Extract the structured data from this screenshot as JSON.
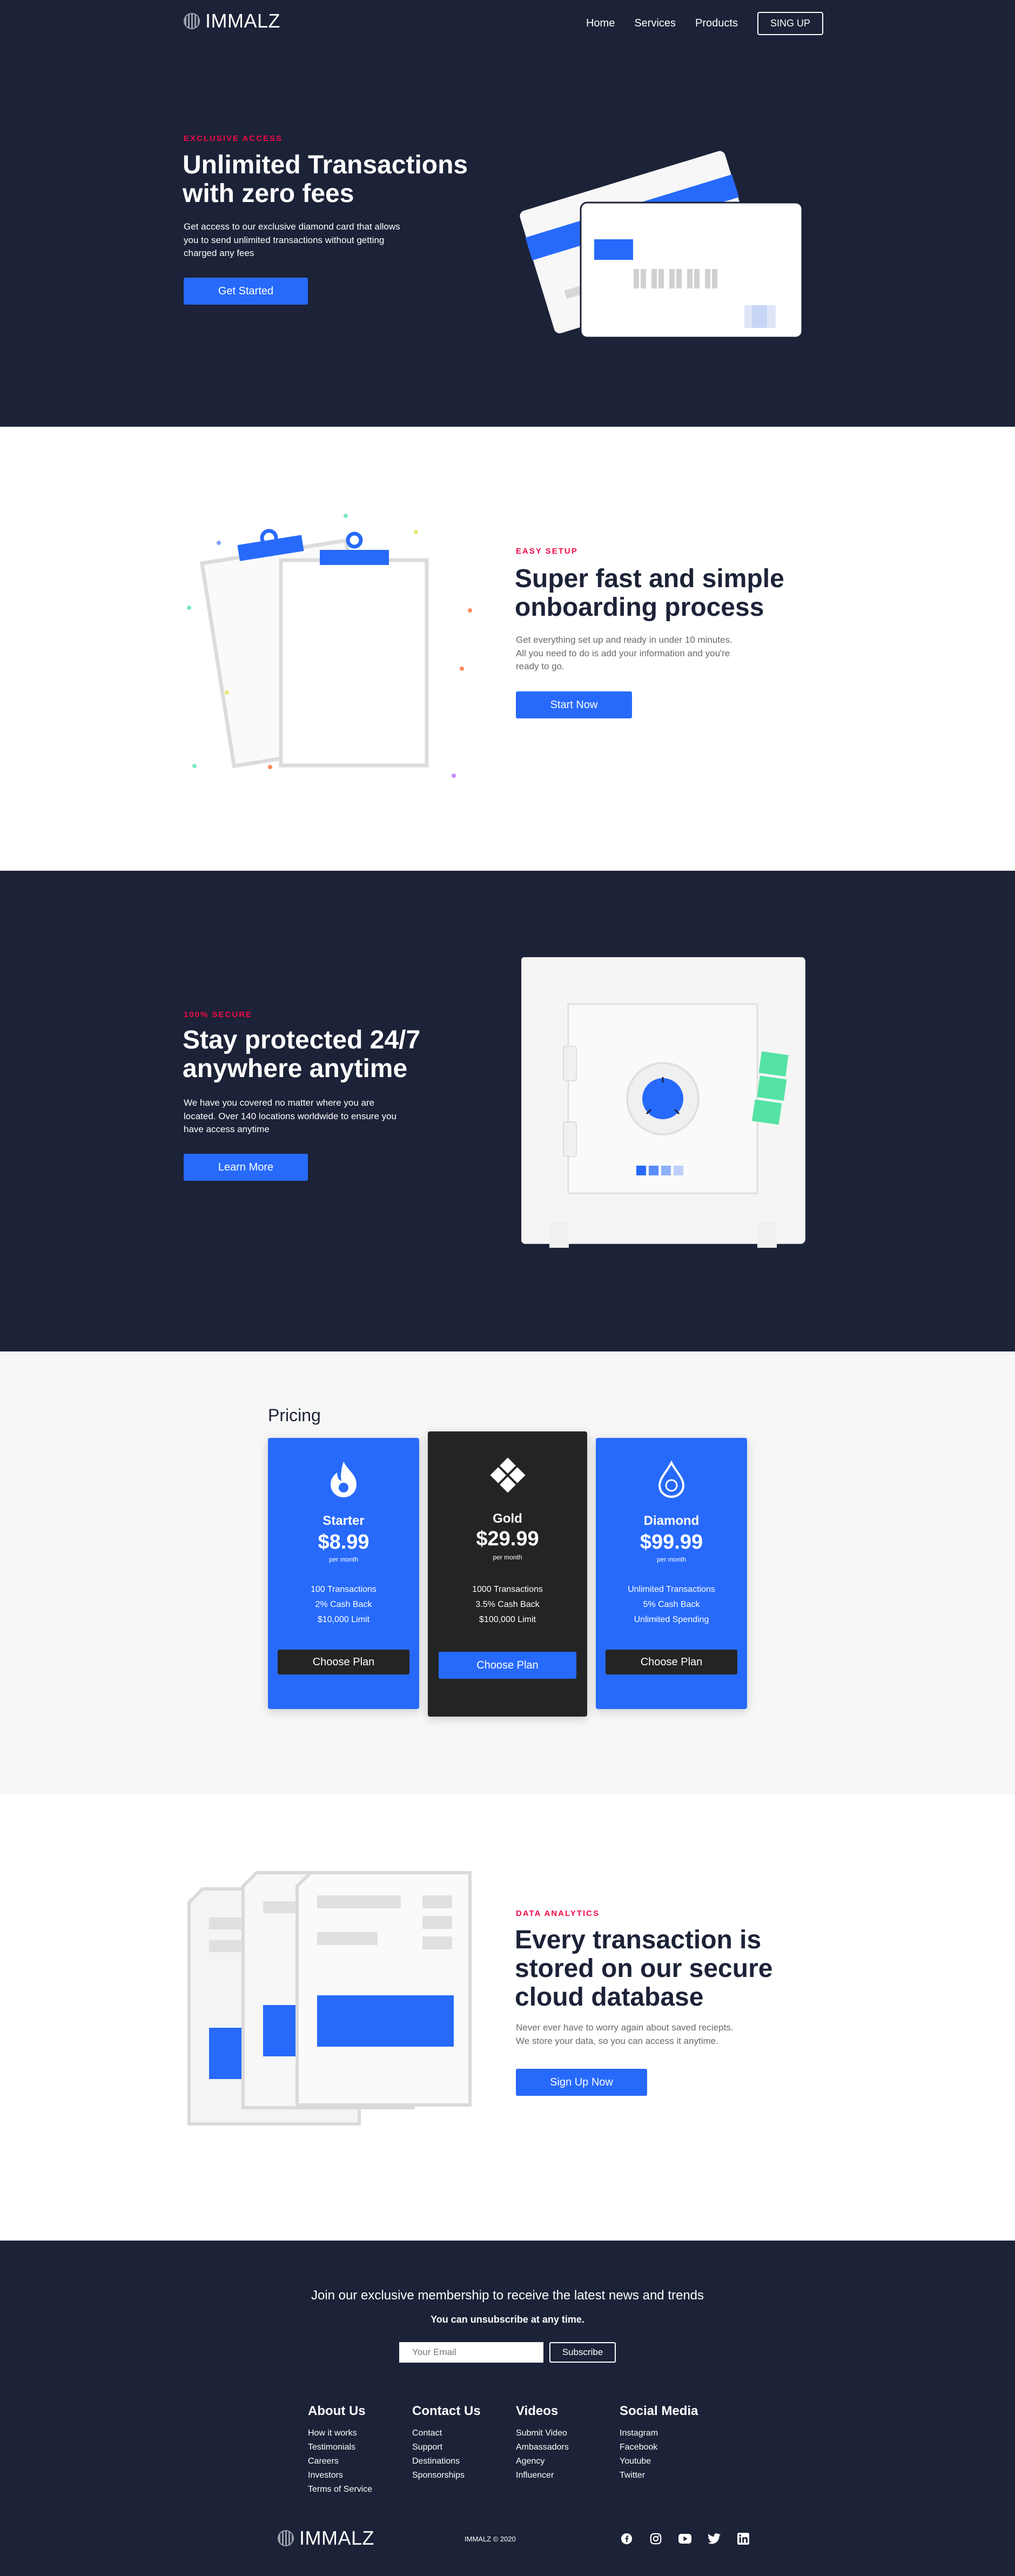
{
  "nav": {
    "brand": "IMMALZ",
    "links": [
      "Home",
      "Services",
      "Products"
    ],
    "cta": "SING UP"
  },
  "hero": {
    "eyebrow": "EXCLUSIVE ACCESS",
    "title_line1": "Unlimited Transactions",
    "title_line2": "with zero fees",
    "body_line1": "Get access to our exclusive diamond card that allows",
    "body_line2": "you to send unlimited transactions without getting",
    "body_line3": "charged any fees",
    "button": "Get Started"
  },
  "onboarding": {
    "eyebrow": "EASY SETUP",
    "title_line1": "Super fast and simple",
    "title_line2": "onboarding process",
    "body_line1": "Get everything set up and ready in under 10 minutes.",
    "body_line2": "All you need to do is add your information and you're",
    "body_line3": "ready to go.",
    "button": "Start Now"
  },
  "security": {
    "eyebrow": "100% SECURE",
    "title_line1": "Stay protected 24/7",
    "title_line2": "anywhere anytime",
    "body_line1": "We have you covered no matter where you are",
    "body_line2": "located. Over 140 locations worldwide to ensure you",
    "body_line3": "have access anytime",
    "button": "Learn More"
  },
  "pricing": {
    "title": "Pricing",
    "plans": [
      {
        "name": "Starter",
        "price": "$8.99",
        "per": "per month",
        "features": [
          "100 Transactions",
          "2% Cash Back",
          "$10,000 Limit"
        ],
        "button": "Choose Plan",
        "icon": "flame-icon",
        "bg": "#276afb",
        "btn_bg": "#242424"
      },
      {
        "name": "Gold",
        "price": "$29.99",
        "per": "per month",
        "features": [
          "1000 Transactions",
          "3.5% Cash Back",
          "$100,000 Limit"
        ],
        "button": "Choose Plan",
        "icon": "diamond-grid-icon",
        "bg": "#242424",
        "btn_bg": "#276afb"
      },
      {
        "name": "Diamond",
        "price": "$99.99",
        "per": "per month",
        "features": [
          "Unlimited Transactions",
          "5% Cash Back",
          "Unlimited Spending"
        ],
        "button": "Choose Plan",
        "icon": "drop-icon",
        "bg": "#276afb",
        "btn_bg": "#242424"
      }
    ]
  },
  "analytics": {
    "eyebrow": "DATA ANALYTICS",
    "title_line1": "Every transaction is",
    "title_line2": "stored on our secure",
    "title_line3": "cloud database",
    "body_line1": "Never ever have to worry again about saved reciepts.",
    "body_line2": "We store your data, so you can access it anytime.",
    "button": "Sign Up Now"
  },
  "footer": {
    "headline": "Join our exclusive membership to receive the latest news and trends",
    "subline": "You can unsubscribe at any time.",
    "email_placeholder": "Your Email",
    "subscribe": "Subscribe",
    "columns": [
      {
        "title": "About Us",
        "links": [
          "How it works",
          "Testimonials",
          "Careers",
          "Investors",
          "Terms of Service"
        ]
      },
      {
        "title": "Contact Us",
        "links": [
          "Contact",
          "Support",
          "Destinations",
          "Sponsorships"
        ]
      },
      {
        "title": "Videos",
        "links": [
          "Submit Video",
          "Ambassadors",
          "Agency",
          "Influencer"
        ]
      },
      {
        "title": "Social Media",
        "links": [
          "Instagram",
          "Facebook",
          "Youtube",
          "Twitter"
        ]
      }
    ],
    "brand": "IMMALZ",
    "copyright": "IMMALZ © 2020",
    "socials": [
      "facebook-icon",
      "instagram-icon",
      "youtube-icon",
      "twitter-icon",
      "linkedin-icon"
    ]
  },
  "colors": {
    "navy": "#1c2237",
    "accent_blue": "#276afb",
    "eyebrow_red": "#f00946",
    "card_dark": "#242424"
  }
}
